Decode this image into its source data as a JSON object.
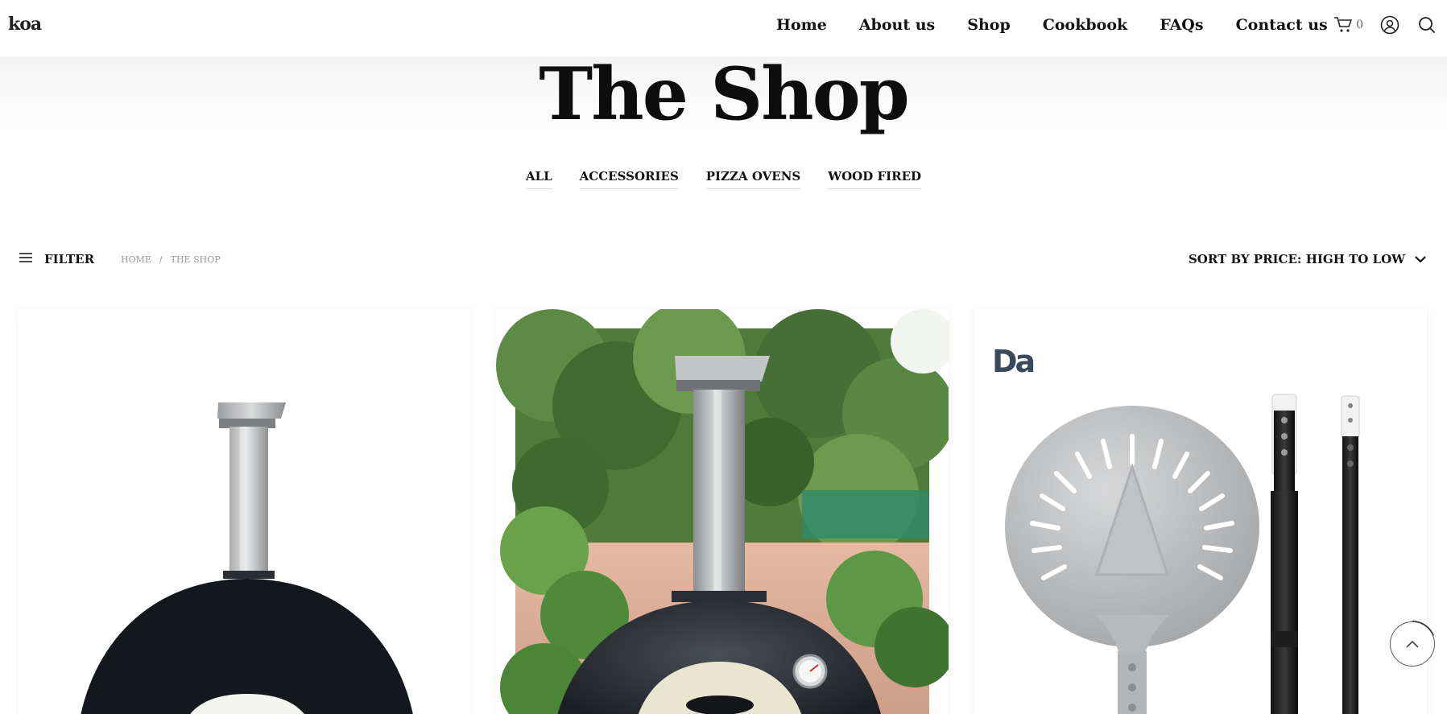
{
  "header": {
    "logo": "koa",
    "nav": [
      "Home",
      "About us",
      "Shop",
      "Cookbook",
      "FAQs",
      "Contact us"
    ],
    "cart_count": "0",
    "icons": {
      "cart": "cart-icon",
      "account": "user-circle-icon",
      "search": "search-icon"
    }
  },
  "page": {
    "title": "The Shop",
    "categories": [
      "ALL",
      "ACCESSORIES",
      "PIZZA OVENS",
      "WOOD FIRED"
    ]
  },
  "toolbar": {
    "filter_label": "FILTER",
    "breadcrumb": [
      "HOME",
      "/",
      "THE SHOP"
    ],
    "sort_label": "SORT BY PRICE: HIGH TO LOW"
  },
  "products": [
    {
      "brand_mark": ""
    },
    {
      "brand_mark": ""
    },
    {
      "brand_mark": "Da"
    }
  ],
  "colors": {
    "accent": "#111111",
    "oven_black": "#14171c",
    "steel": "#c9cbcd"
  }
}
